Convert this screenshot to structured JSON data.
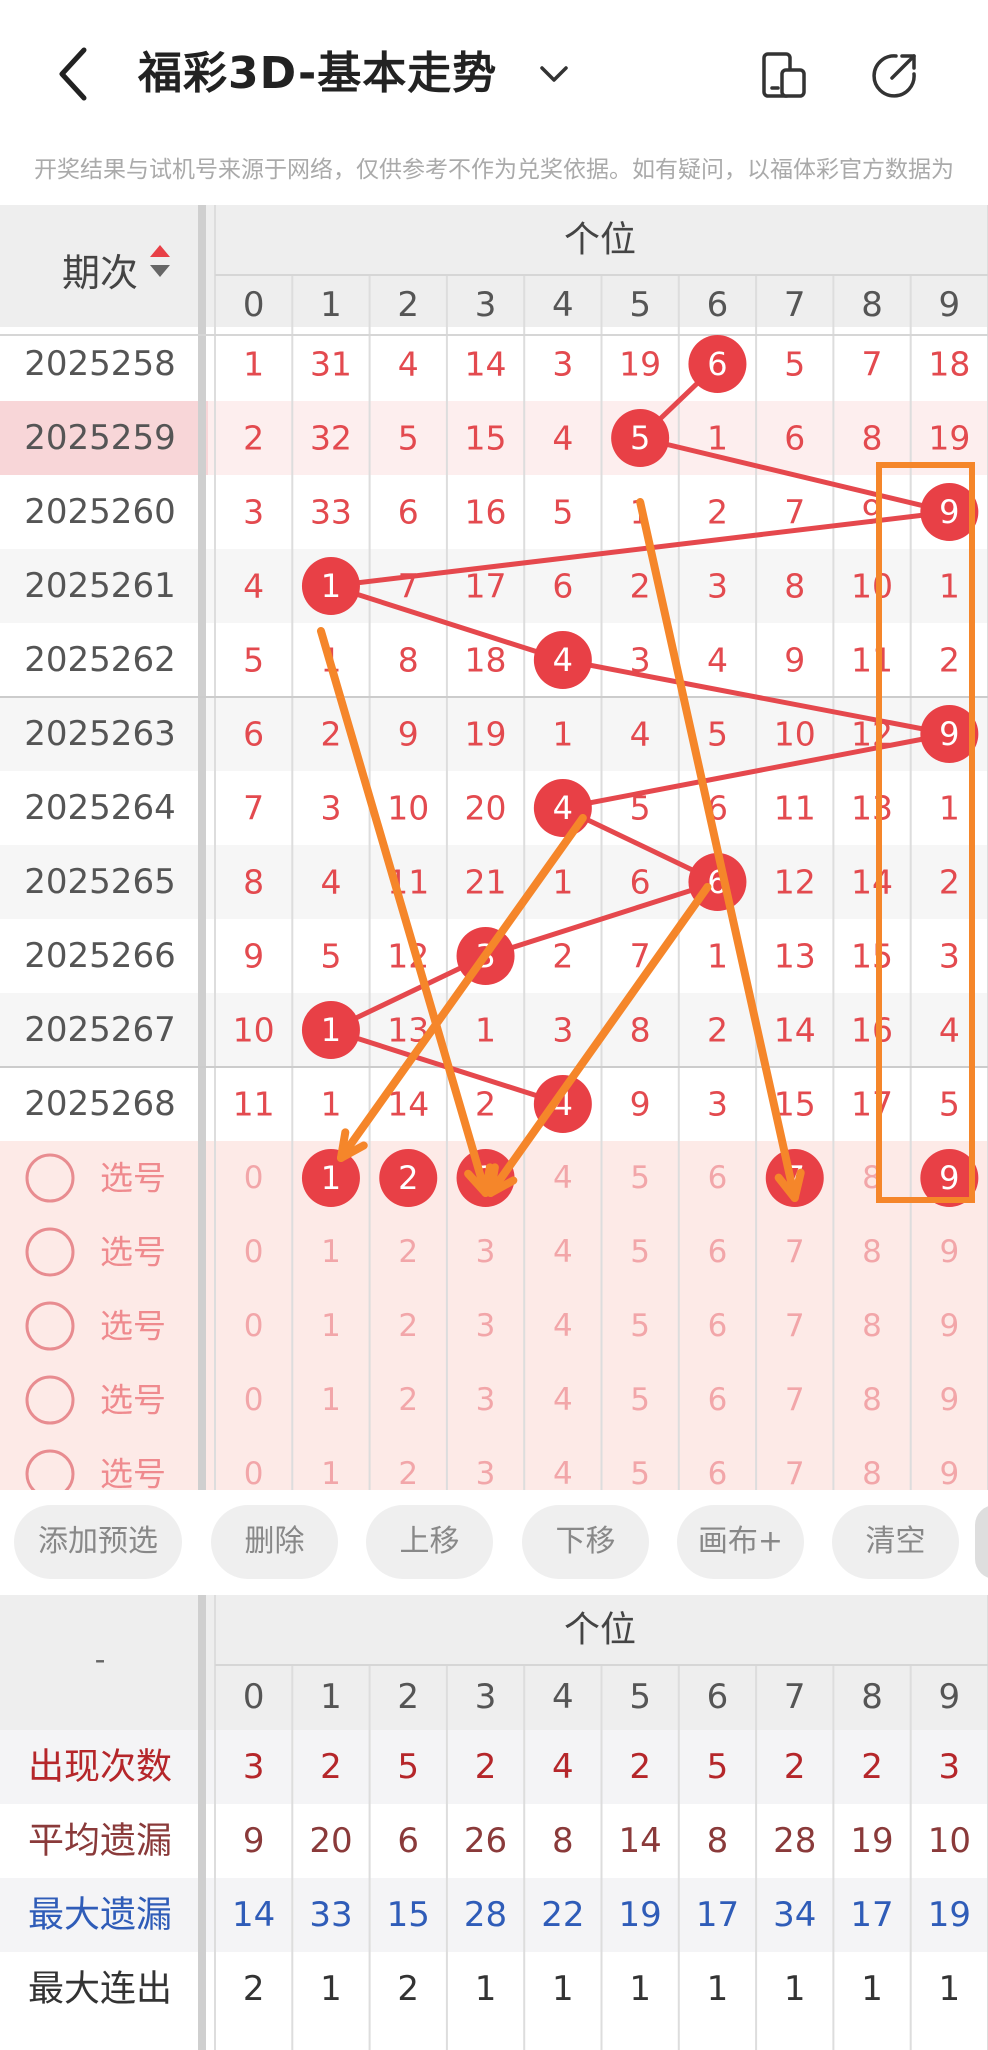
{
  "header": {
    "title": "福彩3D-基本走势",
    "notice": "开奖结果与试机号来源于网络，仅供参考不作为兑奖依据。如有疑问，以福体彩官方数据为"
  },
  "table": {
    "period_header": "期次",
    "section_header": "个位",
    "digits": [
      "0",
      "1",
      "2",
      "3",
      "4",
      "5",
      "6",
      "7",
      "8",
      "9"
    ],
    "rows": [
      {
        "period": "2025258",
        "cells": [
          "1",
          "31",
          "4",
          "14",
          "3",
          "19",
          "6",
          "5",
          "7",
          "18"
        ],
        "hit": 6
      },
      {
        "period": "2025259",
        "cells": [
          "2",
          "32",
          "5",
          "15",
          "4",
          "5",
          "1",
          "6",
          "8",
          "19"
        ],
        "hit": 5
      },
      {
        "period": "2025260",
        "cells": [
          "3",
          "33",
          "6",
          "16",
          "5",
          "1",
          "2",
          "7",
          "9",
          "9"
        ],
        "hit": 9
      },
      {
        "period": "2025261",
        "cells": [
          "4",
          "1",
          "7",
          "17",
          "6",
          "2",
          "3",
          "8",
          "10",
          "1"
        ],
        "hit": 1
      },
      {
        "period": "2025262",
        "cells": [
          "5",
          "1",
          "8",
          "18",
          "4",
          "3",
          "4",
          "9",
          "11",
          "2"
        ],
        "hit": 4
      },
      {
        "period": "2025263",
        "cells": [
          "6",
          "2",
          "9",
          "19",
          "1",
          "4",
          "5",
          "10",
          "12",
          "9"
        ],
        "hit": 9
      },
      {
        "period": "2025264",
        "cells": [
          "7",
          "3",
          "10",
          "20",
          "4",
          "5",
          "6",
          "11",
          "13",
          "1"
        ],
        "hit": 4
      },
      {
        "period": "2025265",
        "cells": [
          "8",
          "4",
          "11",
          "21",
          "1",
          "6",
          "6",
          "12",
          "14",
          "2"
        ],
        "hit": 6
      },
      {
        "period": "2025266",
        "cells": [
          "9",
          "5",
          "12",
          "3",
          "2",
          "7",
          "1",
          "13",
          "15",
          "3"
        ],
        "hit": 3
      },
      {
        "period": "2025267",
        "cells": [
          "10",
          "1",
          "13",
          "1",
          "3",
          "8",
          "2",
          "14",
          "16",
          "4"
        ],
        "hit": 1
      },
      {
        "period": "2025268",
        "cells": [
          "11",
          "1",
          "14",
          "2",
          "4",
          "9",
          "3",
          "15",
          "17",
          "5"
        ],
        "hit": 4
      }
    ],
    "select_label": "选号",
    "select_rows": [
      {
        "chosen": [
          1,
          2,
          3,
          7,
          9
        ]
      },
      {
        "chosen": []
      },
      {
        "chosen": []
      },
      {
        "chosen": []
      },
      {
        "chosen": []
      }
    ]
  },
  "toolbar": [
    "添加预选",
    "删除",
    "上移",
    "下移",
    "画布+",
    "清空"
  ],
  "stats": {
    "corner": "-",
    "section_header": "个位",
    "digits": [
      "0",
      "1",
      "2",
      "3",
      "4",
      "5",
      "6",
      "7",
      "8",
      "9"
    ],
    "rows": [
      {
        "label": "出现次数",
        "values": [
          "3",
          "2",
          "5",
          "2",
          "4",
          "2",
          "5",
          "2",
          "2",
          "3"
        ],
        "color": "#b5262a"
      },
      {
        "label": "平均遗漏",
        "values": [
          "9",
          "20",
          "6",
          "26",
          "8",
          "14",
          "8",
          "28",
          "19",
          "10"
        ],
        "color": "#8a3a3a"
      },
      {
        "label": "最大遗漏",
        "values": [
          "14",
          "33",
          "15",
          "28",
          "22",
          "19",
          "17",
          "34",
          "17",
          "19"
        ],
        "color": "#2f5cb8"
      },
      {
        "label": "最大连出",
        "values": [
          "2",
          "1",
          "2",
          "1",
          "1",
          "1",
          "1",
          "1",
          "1",
          "1"
        ],
        "color": "#333333"
      }
    ]
  },
  "colors": {
    "red": "#e84046",
    "orange": "#f5862a",
    "accent_pink": "#f8d6d8",
    "select_bg": "#fdeae7"
  }
}
